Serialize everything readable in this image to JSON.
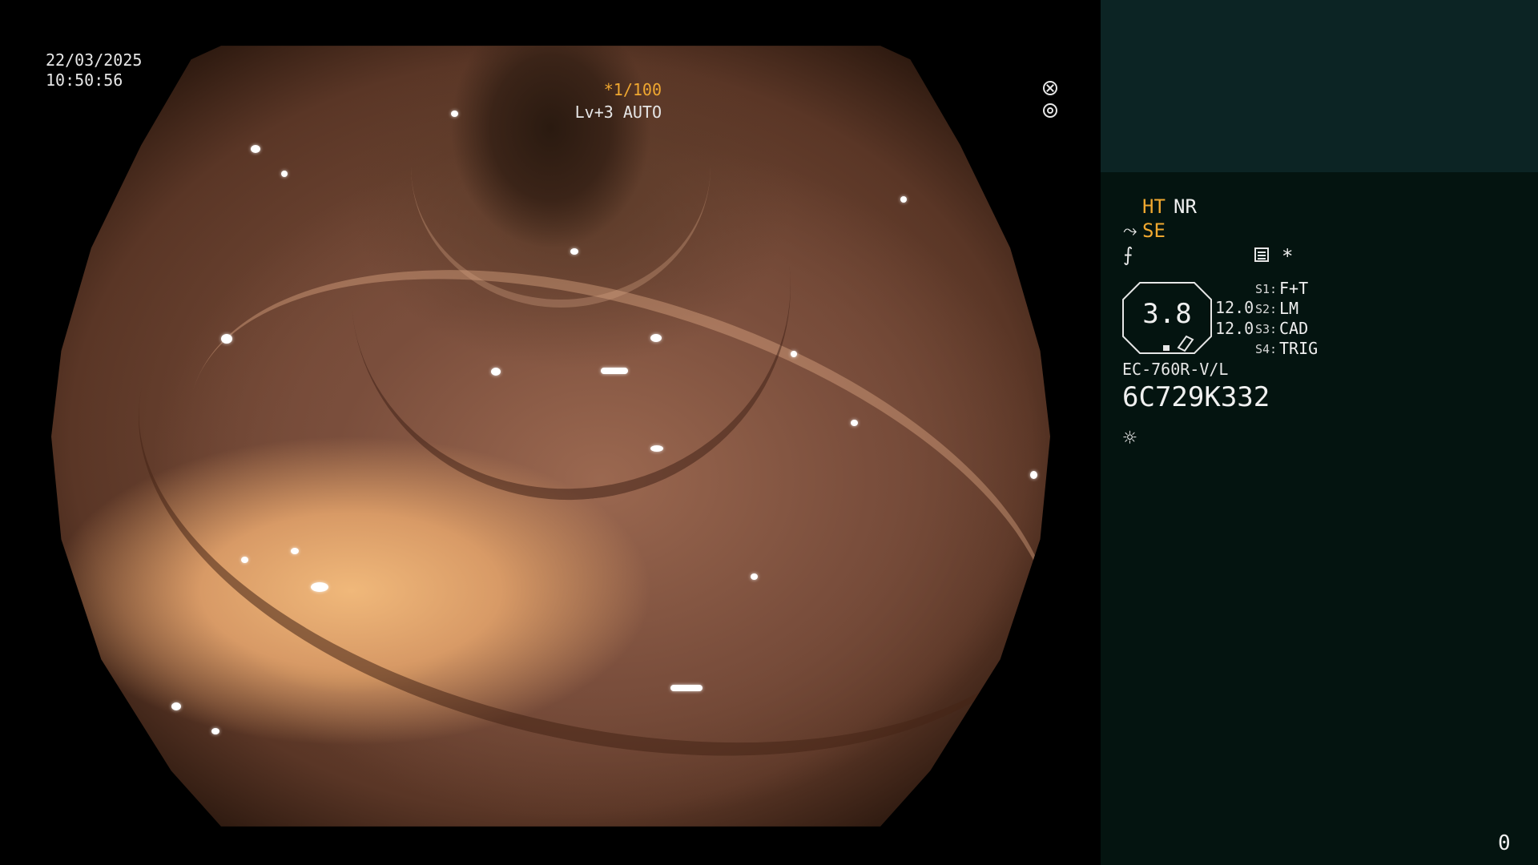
{
  "timestamp": {
    "date": "22/03/2025",
    "time": "10:50:56"
  },
  "shutter": {
    "value": "*1/100",
    "icon": "shutter-icon",
    "color": "#f0a830"
  },
  "iris": {
    "value": "Lv+3 AUTO",
    "icon": "iris-icon"
  },
  "panel": {
    "ht": "HT",
    "nr": "NR",
    "se": "SE",
    "cable_icon": "⤳",
    "fstop_icon": "⨍",
    "star": "*",
    "zoom": "3.8",
    "values": [
      "12.0",
      "12.0"
    ],
    "switches": [
      {
        "key": "S1:",
        "value": "F+T"
      },
      {
        "key": "S2:",
        "value": "LM"
      },
      {
        "key": "S3:",
        "value": "CAD"
      },
      {
        "key": "S4:",
        "value": "TRIG"
      }
    ],
    "model": "EC-760R-V/L",
    "serial": "6C729K332",
    "light_icon": "☼",
    "accent_color": "#f0a830",
    "panel_color": "#041410"
  },
  "counter": "0"
}
